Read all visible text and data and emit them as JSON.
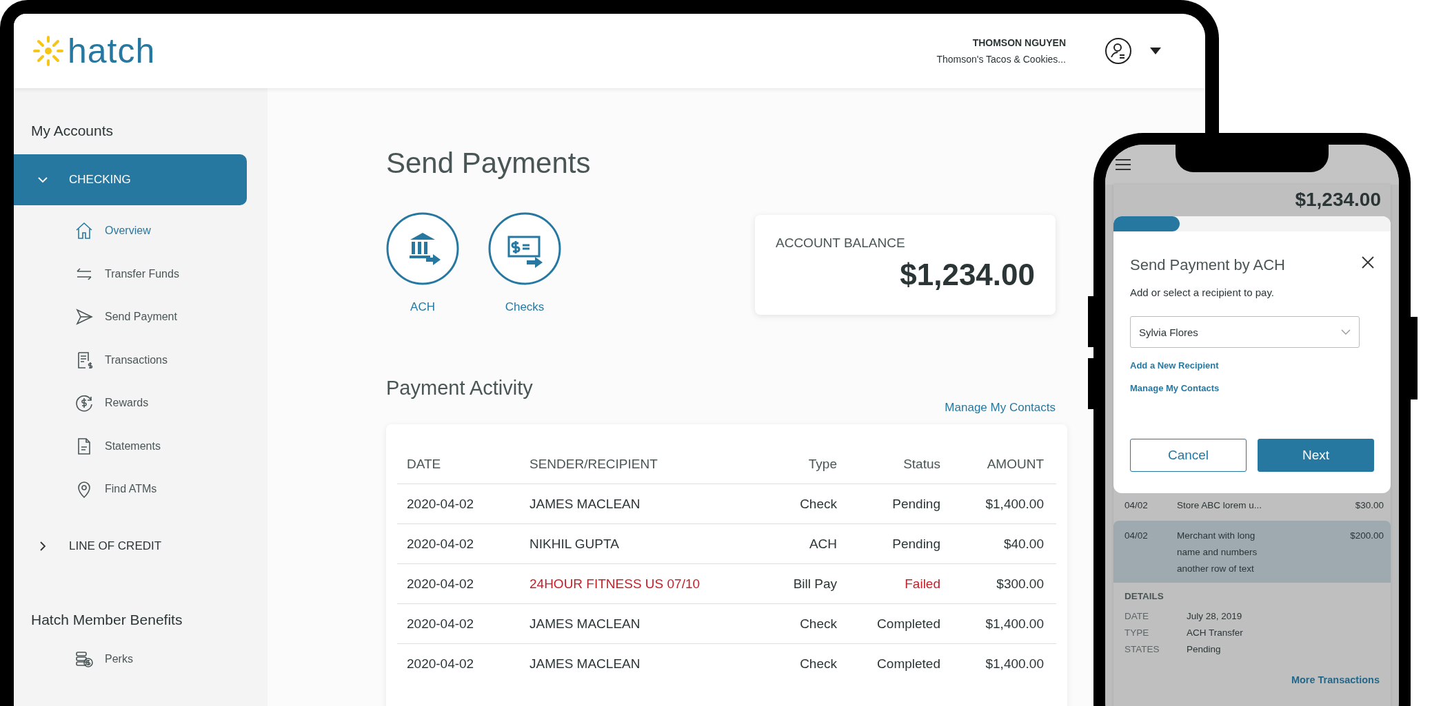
{
  "header": {
    "logo": "hatch",
    "user_name": "THOMSON NGUYEN",
    "company": "Thomson's Tacos & Cookies..."
  },
  "sidebar": {
    "section_title": "My Accounts",
    "accounts": [
      {
        "label": "CHECKING",
        "expanded": true,
        "selected": true,
        "children": [
          {
            "label": "Overview",
            "selected": true
          },
          {
            "label": "Transfer Funds",
            "selected": false
          },
          {
            "label": "Send Payment",
            "selected": false
          },
          {
            "label": "Transactions",
            "selected": false
          },
          {
            "label": "Rewards",
            "selected": false
          },
          {
            "label": "Statements",
            "selected": false
          },
          {
            "label": "Find ATMs",
            "selected": false
          }
        ]
      },
      {
        "label": "LINE OF CREDIT",
        "expanded": false,
        "selected": false
      }
    ],
    "benefits_title": "Hatch Member Benefits",
    "benefits": [
      {
        "label": "Perks",
        "selected": false
      }
    ]
  },
  "main": {
    "title": "Send Payments",
    "payment_methods": [
      {
        "label": "ACH"
      },
      {
        "label": "Checks"
      }
    ],
    "balance": {
      "label": "ACCOUNT BALANCE",
      "amount": "$1,234.00"
    },
    "activity_title": "Payment Activity",
    "manage_link": "Manage My Contacts",
    "table": {
      "columns": [
        "DATE",
        "SENDER/RECIPIENT",
        "Type",
        "Status",
        "AMOUNT"
      ],
      "rows": [
        {
          "cells": [
            "2020-04-02",
            "JAMES MACLEAN",
            "Check",
            "Pending",
            "$1,400.00"
          ],
          "failed": false
        },
        {
          "cells": [
            "2020-04-02",
            "NIKHIL GUPTA",
            "ACH",
            "Pending",
            "$40.00"
          ],
          "failed": false
        },
        {
          "cells": [
            "2020-04-02",
            "24HOUR FITNESS US 07/10",
            "Bill Pay",
            "Failed",
            "$300.00"
          ],
          "failed": true
        },
        {
          "cells": [
            "2020-04-02",
            "JAMES MACLEAN",
            "Check",
            "Completed",
            "$1,400.00"
          ],
          "failed": false
        },
        {
          "cells": [
            "2020-04-02",
            "JAMES MACLEAN",
            "Check",
            "Completed",
            "$1,400.00"
          ],
          "failed": false
        }
      ]
    }
  },
  "phone": {
    "balance": "$1,234.00",
    "modal": {
      "progress": {
        "level": 0.24
      },
      "title": "Send Payment by ACH",
      "instruction": "Add or select a recipient to pay.",
      "recipient_select": {
        "value": "Sylvia Flores"
      },
      "links": [
        "Add a New Recipient",
        "Manage My Contacts"
      ],
      "buttons": [
        {
          "label": "Cancel",
          "kind": "secondary"
        },
        {
          "label": "Next",
          "kind": "primary"
        }
      ]
    },
    "transactions": [
      {
        "date": "04/02",
        "description": "Store ABC lorem u...",
        "amount": "$30.00",
        "selected": false
      },
      {
        "date": "04/02",
        "description": "Merchant with long name and numbers another row of text",
        "amount": "$200.00",
        "selected": true
      }
    ],
    "details": {
      "title": "DETAILS",
      "rows": [
        {
          "label": "DATE",
          "value": "July 28, 2019"
        },
        {
          "label": "TYPE",
          "value": "ACH Transfer"
        },
        {
          "label": "STATES",
          "value": "Pending"
        }
      ]
    },
    "more_link": "More Transactions"
  }
}
